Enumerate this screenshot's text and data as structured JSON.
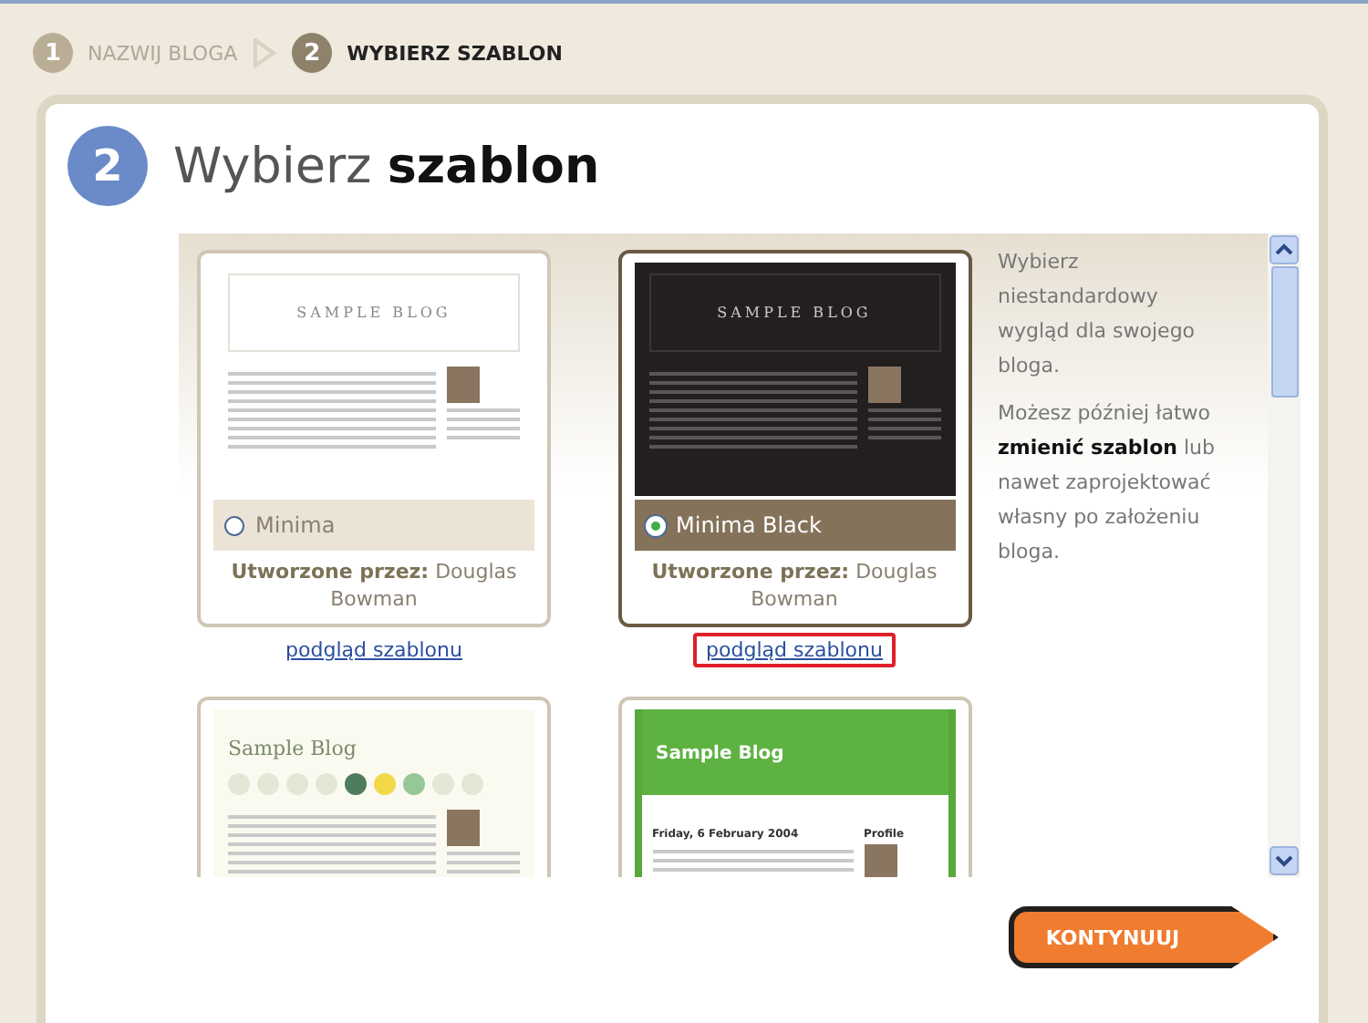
{
  "steps": [
    {
      "number": "1",
      "label": "NAZWIJ BLOGA",
      "selected": false
    },
    {
      "number": "2",
      "label": "WYBIERZ SZABLON",
      "selected": true
    }
  ],
  "heading": {
    "number": "2",
    "title": "Wybierz **szablon**"
  },
  "templates": [
    {
      "kind": "minima",
      "thumb_title": "SAMPLE BLOG",
      "name": "Minima",
      "author_label": "Utworzone przez:",
      "author": "Douglas Bowman",
      "link": "podgląd szablonu",
      "selected": false,
      "link_highlighted": false
    },
    {
      "kind": "minima-black",
      "thumb_title": "SAMPLE BLOG",
      "name": "Minima Black",
      "author_label": "Utworzone przez:",
      "author": "Douglas Bowman",
      "link": "podgląd szablonu",
      "selected": true,
      "link_highlighted": true
    },
    {
      "kind": "dots",
      "thumb_title": "Sample Blog"
    },
    {
      "kind": "green",
      "thumb_title": "Sample Blog",
      "thumb_date": "Friday, 6 February 2004",
      "thumb_side": "Profile"
    }
  ],
  "info": [
    "Wybierz niestandardowy wygląd dla swojego bloga.",
    "Możesz później łatwo **zmienić szablon** lub nawet zaprojektować własny po założeniu bloga."
  ],
  "continue_button": "KONTYNUUJ"
}
